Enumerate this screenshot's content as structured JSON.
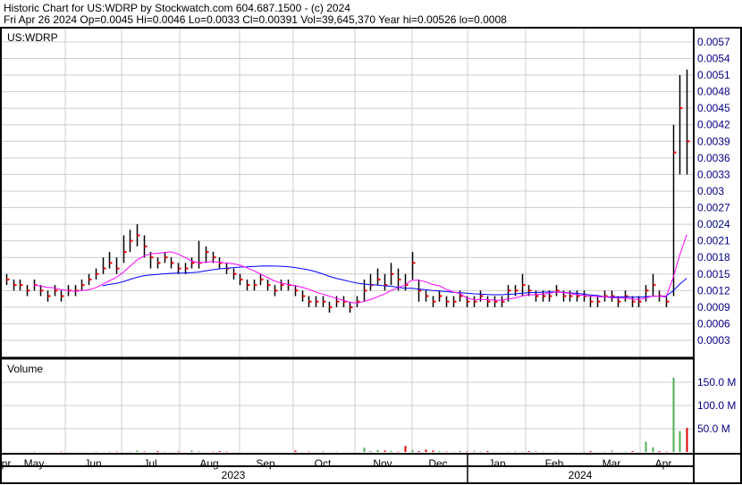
{
  "header": {
    "line1": "Historic Chart for US:WDRP by Stockwatch.com 604.687.1500 - (c) 2024",
    "line2": "Fri Apr 26 2024   Op=0.0045   Hi=0.0046   Lo=0.0033   Cl=0.00391   Vol=39,645,370   Year hi=0.00526   lo=0.0008"
  },
  "chart_data": {
    "type": "ohlc",
    "symbol": "US:WDRP",
    "volume_label": "Volume",
    "price_ticks": [
      "0.0057",
      "0.0054",
      "0.0051",
      "0.0048",
      "0.0045",
      "0.0042",
      "0.0039",
      "0.0036",
      "0.0033",
      "0.003",
      "0.0027",
      "0.0024",
      "0.0021",
      "0.0018",
      "0.0015",
      "0.0012",
      "0.0009",
      "0.0006",
      "0.0003"
    ],
    "price_range": [
      0,
      0.0059
    ],
    "volume_ticks": [
      "150.0 M",
      "100.0 M",
      "50.0 M"
    ],
    "volume_tick_values": [
      150,
      100,
      50
    ],
    "months": [
      "pr",
      "May",
      "Jun",
      "Jul",
      "Aug",
      "Sep",
      "Oct",
      "Nov",
      "Dec",
      "Jan",
      "Feb",
      "Mar",
      "Apr"
    ],
    "years": [
      "2023",
      "2024"
    ],
    "colors": {
      "up": "#4caf50",
      "down": "#e00000",
      "flat": "#aaaaaa",
      "ma_short": "#ff00ff",
      "ma_long": "#0000ff",
      "bar": "#000000",
      "close_tick": "#ff0000",
      "grid": "#cccccc"
    },
    "close": [
      14,
      13,
      13,
      12,
      13,
      12,
      11,
      12,
      11,
      12,
      12,
      13,
      14,
      15,
      16,
      17,
      16,
      19,
      21,
      22,
      20,
      18,
      17,
      18,
      17,
      16,
      16,
      17,
      17,
      19,
      18,
      17,
      16,
      15,
      14,
      13,
      13,
      14,
      13,
      12,
      13,
      13,
      12,
      11,
      10,
      10,
      10,
      9,
      10,
      10,
      9,
      10,
      12,
      13,
      14,
      13,
      15,
      14,
      13,
      17,
      12,
      11,
      10,
      11,
      10,
      10,
      11,
      10,
      10,
      11,
      10,
      10,
      10,
      12,
      12,
      13,
      12,
      11,
      11,
      11,
      12,
      11,
      11,
      11,
      11,
      10,
      10,
      11,
      11,
      10,
      11,
      10,
      10,
      12,
      13,
      11,
      10,
      37,
      45,
      39
    ],
    "high": [
      15,
      14,
      14,
      13,
      14,
      13,
      12,
      13,
      12,
      13,
      13,
      14,
      15,
      16,
      18,
      19,
      18,
      22,
      23,
      24,
      22,
      19,
      18,
      19,
      18,
      17,
      17,
      18,
      21,
      20,
      19,
      18,
      17,
      16,
      15,
      14,
      14,
      15,
      14,
      13,
      14,
      14,
      13,
      12,
      11,
      11,
      11,
      10,
      11,
      11,
      10,
      11,
      14,
      15,
      16,
      15,
      17,
      16,
      15,
      19,
      14,
      12,
      11,
      12,
      11,
      11,
      12,
      11,
      11,
      12,
      11,
      11,
      11,
      13,
      13,
      15,
      13,
      12,
      12,
      12,
      13,
      12,
      12,
      12,
      12,
      11,
      11,
      12,
      12,
      11,
      12,
      11,
      11,
      13,
      15,
      12,
      11,
      42,
      51,
      52
    ],
    "low": [
      13,
      12,
      12,
      11,
      12,
      11,
      10,
      11,
      10,
      11,
      11,
      12,
      13,
      14,
      15,
      16,
      15,
      17,
      19,
      20,
      18,
      16,
      16,
      17,
      16,
      15,
      15,
      16,
      16,
      17,
      17,
      16,
      15,
      14,
      13,
      12,
      12,
      13,
      12,
      11,
      12,
      12,
      11,
      10,
      9,
      9,
      9,
      8,
      9,
      9,
      8,
      9,
      10,
      12,
      13,
      12,
      13,
      12,
      12,
      14,
      10,
      10,
      9,
      10,
      9,
      9,
      10,
      9,
      9,
      10,
      9,
      9,
      9,
      10,
      11,
      11,
      11,
      10,
      10,
      10,
      11,
      10,
      10,
      10,
      10,
      9,
      9,
      10,
      10,
      9,
      10,
      9,
      9,
      10,
      11,
      10,
      9,
      11,
      33,
      33
    ],
    "price_unit": 0.0001,
    "volume_m": [
      0,
      0,
      0,
      0,
      1,
      0,
      0,
      0,
      1,
      0,
      0,
      0,
      0,
      1,
      0,
      1,
      1,
      0,
      1,
      3,
      1,
      0,
      2,
      1,
      0,
      1,
      0,
      3,
      2,
      0,
      1,
      2,
      1,
      0,
      0,
      0,
      0,
      0,
      0,
      0,
      0,
      0,
      3,
      0,
      1,
      0,
      2,
      0,
      1,
      0,
      0,
      0,
      9,
      2,
      4,
      3,
      2,
      1,
      13,
      4,
      2,
      5,
      3,
      2,
      1,
      1,
      2,
      1,
      3,
      1,
      2,
      1,
      0,
      1,
      2,
      1,
      2,
      1,
      1,
      0,
      1,
      0,
      0,
      0,
      1,
      2,
      0,
      1,
      4,
      0,
      1,
      2,
      0,
      22,
      10,
      2,
      1,
      160,
      45,
      52
    ]
  }
}
